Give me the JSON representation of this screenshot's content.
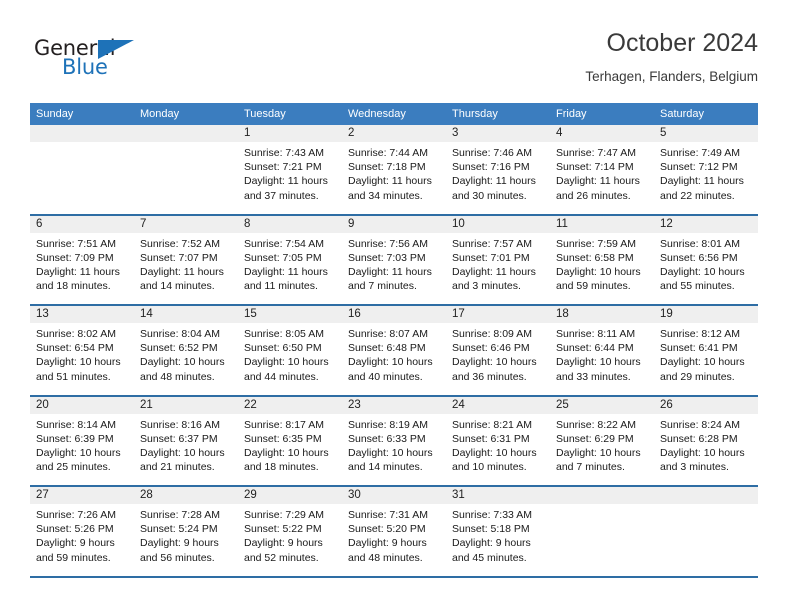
{
  "brand": {
    "logo_text_top": "General",
    "logo_text_bottom": "Blue",
    "logo_icon": "triangle-flag-icon",
    "color_dark": "#231f20",
    "color_blue": "#1e72b8"
  },
  "header": {
    "month_title": "October 2024",
    "location": "Terhagen, Flanders, Belgium"
  },
  "theme": {
    "header_row_bg": "#3b7dbf",
    "week_divider": "#2e6da4",
    "day_number_bg": "#efefef"
  },
  "weekdays": [
    "Sunday",
    "Monday",
    "Tuesday",
    "Wednesday",
    "Thursday",
    "Friday",
    "Saturday"
  ],
  "weeks": [
    [
      {
        "day": "",
        "empty": true,
        "sunrise": "",
        "sunset": "",
        "daylight_line1": "",
        "daylight_line2": ""
      },
      {
        "day": "",
        "empty": true,
        "sunrise": "",
        "sunset": "",
        "daylight_line1": "",
        "daylight_line2": ""
      },
      {
        "day": "1",
        "sunrise": "Sunrise: 7:43 AM",
        "sunset": "Sunset: 7:21 PM",
        "daylight_line1": "Daylight: 11 hours",
        "daylight_line2": "and 37 minutes."
      },
      {
        "day": "2",
        "sunrise": "Sunrise: 7:44 AM",
        "sunset": "Sunset: 7:18 PM",
        "daylight_line1": "Daylight: 11 hours",
        "daylight_line2": "and 34 minutes."
      },
      {
        "day": "3",
        "sunrise": "Sunrise: 7:46 AM",
        "sunset": "Sunset: 7:16 PM",
        "daylight_line1": "Daylight: 11 hours",
        "daylight_line2": "and 30 minutes."
      },
      {
        "day": "4",
        "sunrise": "Sunrise: 7:47 AM",
        "sunset": "Sunset: 7:14 PM",
        "daylight_line1": "Daylight: 11 hours",
        "daylight_line2": "and 26 minutes."
      },
      {
        "day": "5",
        "sunrise": "Sunrise: 7:49 AM",
        "sunset": "Sunset: 7:12 PM",
        "daylight_line1": "Daylight: 11 hours",
        "daylight_line2": "and 22 minutes."
      }
    ],
    [
      {
        "day": "6",
        "sunrise": "Sunrise: 7:51 AM",
        "sunset": "Sunset: 7:09 PM",
        "daylight_line1": "Daylight: 11 hours",
        "daylight_line2": "and 18 minutes."
      },
      {
        "day": "7",
        "sunrise": "Sunrise: 7:52 AM",
        "sunset": "Sunset: 7:07 PM",
        "daylight_line1": "Daylight: 11 hours",
        "daylight_line2": "and 14 minutes."
      },
      {
        "day": "8",
        "sunrise": "Sunrise: 7:54 AM",
        "sunset": "Sunset: 7:05 PM",
        "daylight_line1": "Daylight: 11 hours",
        "daylight_line2": "and 11 minutes."
      },
      {
        "day": "9",
        "sunrise": "Sunrise: 7:56 AM",
        "sunset": "Sunset: 7:03 PM",
        "daylight_line1": "Daylight: 11 hours",
        "daylight_line2": "and 7 minutes."
      },
      {
        "day": "10",
        "sunrise": "Sunrise: 7:57 AM",
        "sunset": "Sunset: 7:01 PM",
        "daylight_line1": "Daylight: 11 hours",
        "daylight_line2": "and 3 minutes."
      },
      {
        "day": "11",
        "sunrise": "Sunrise: 7:59 AM",
        "sunset": "Sunset: 6:58 PM",
        "daylight_line1": "Daylight: 10 hours",
        "daylight_line2": "and 59 minutes."
      },
      {
        "day": "12",
        "sunrise": "Sunrise: 8:01 AM",
        "sunset": "Sunset: 6:56 PM",
        "daylight_line1": "Daylight: 10 hours",
        "daylight_line2": "and 55 minutes."
      }
    ],
    [
      {
        "day": "13",
        "sunrise": "Sunrise: 8:02 AM",
        "sunset": "Sunset: 6:54 PM",
        "daylight_line1": "Daylight: 10 hours",
        "daylight_line2": "and 51 minutes."
      },
      {
        "day": "14",
        "sunrise": "Sunrise: 8:04 AM",
        "sunset": "Sunset: 6:52 PM",
        "daylight_line1": "Daylight: 10 hours",
        "daylight_line2": "and 48 minutes."
      },
      {
        "day": "15",
        "sunrise": "Sunrise: 8:05 AM",
        "sunset": "Sunset: 6:50 PM",
        "daylight_line1": "Daylight: 10 hours",
        "daylight_line2": "and 44 minutes."
      },
      {
        "day": "16",
        "sunrise": "Sunrise: 8:07 AM",
        "sunset": "Sunset: 6:48 PM",
        "daylight_line1": "Daylight: 10 hours",
        "daylight_line2": "and 40 minutes."
      },
      {
        "day": "17",
        "sunrise": "Sunrise: 8:09 AM",
        "sunset": "Sunset: 6:46 PM",
        "daylight_line1": "Daylight: 10 hours",
        "daylight_line2": "and 36 minutes."
      },
      {
        "day": "18",
        "sunrise": "Sunrise: 8:11 AM",
        "sunset": "Sunset: 6:44 PM",
        "daylight_line1": "Daylight: 10 hours",
        "daylight_line2": "and 33 minutes."
      },
      {
        "day": "19",
        "sunrise": "Sunrise: 8:12 AM",
        "sunset": "Sunset: 6:41 PM",
        "daylight_line1": "Daylight: 10 hours",
        "daylight_line2": "and 29 minutes."
      }
    ],
    [
      {
        "day": "20",
        "sunrise": "Sunrise: 8:14 AM",
        "sunset": "Sunset: 6:39 PM",
        "daylight_line1": "Daylight: 10 hours",
        "daylight_line2": "and 25 minutes."
      },
      {
        "day": "21",
        "sunrise": "Sunrise: 8:16 AM",
        "sunset": "Sunset: 6:37 PM",
        "daylight_line1": "Daylight: 10 hours",
        "daylight_line2": "and 21 minutes."
      },
      {
        "day": "22",
        "sunrise": "Sunrise: 8:17 AM",
        "sunset": "Sunset: 6:35 PM",
        "daylight_line1": "Daylight: 10 hours",
        "daylight_line2": "and 18 minutes."
      },
      {
        "day": "23",
        "sunrise": "Sunrise: 8:19 AM",
        "sunset": "Sunset: 6:33 PM",
        "daylight_line1": "Daylight: 10 hours",
        "daylight_line2": "and 14 minutes."
      },
      {
        "day": "24",
        "sunrise": "Sunrise: 8:21 AM",
        "sunset": "Sunset: 6:31 PM",
        "daylight_line1": "Daylight: 10 hours",
        "daylight_line2": "and 10 minutes."
      },
      {
        "day": "25",
        "sunrise": "Sunrise: 8:22 AM",
        "sunset": "Sunset: 6:29 PM",
        "daylight_line1": "Daylight: 10 hours",
        "daylight_line2": "and 7 minutes."
      },
      {
        "day": "26",
        "sunrise": "Sunrise: 8:24 AM",
        "sunset": "Sunset: 6:28 PM",
        "daylight_line1": "Daylight: 10 hours",
        "daylight_line2": "and 3 minutes."
      }
    ],
    [
      {
        "day": "27",
        "sunrise": "Sunrise: 7:26 AM",
        "sunset": "Sunset: 5:26 PM",
        "daylight_line1": "Daylight: 9 hours",
        "daylight_line2": "and 59 minutes."
      },
      {
        "day": "28",
        "sunrise": "Sunrise: 7:28 AM",
        "sunset": "Sunset: 5:24 PM",
        "daylight_line1": "Daylight: 9 hours",
        "daylight_line2": "and 56 minutes."
      },
      {
        "day": "29",
        "sunrise": "Sunrise: 7:29 AM",
        "sunset": "Sunset: 5:22 PM",
        "daylight_line1": "Daylight: 9 hours",
        "daylight_line2": "and 52 minutes."
      },
      {
        "day": "30",
        "sunrise": "Sunrise: 7:31 AM",
        "sunset": "Sunset: 5:20 PM",
        "daylight_line1": "Daylight: 9 hours",
        "daylight_line2": "and 48 minutes."
      },
      {
        "day": "31",
        "sunrise": "Sunrise: 7:33 AM",
        "sunset": "Sunset: 5:18 PM",
        "daylight_line1": "Daylight: 9 hours",
        "daylight_line2": "and 45 minutes."
      },
      {
        "day": "",
        "empty": true,
        "sunrise": "",
        "sunset": "",
        "daylight_line1": "",
        "daylight_line2": ""
      },
      {
        "day": "",
        "empty": true,
        "sunrise": "",
        "sunset": "",
        "daylight_line1": "",
        "daylight_line2": ""
      }
    ]
  ]
}
